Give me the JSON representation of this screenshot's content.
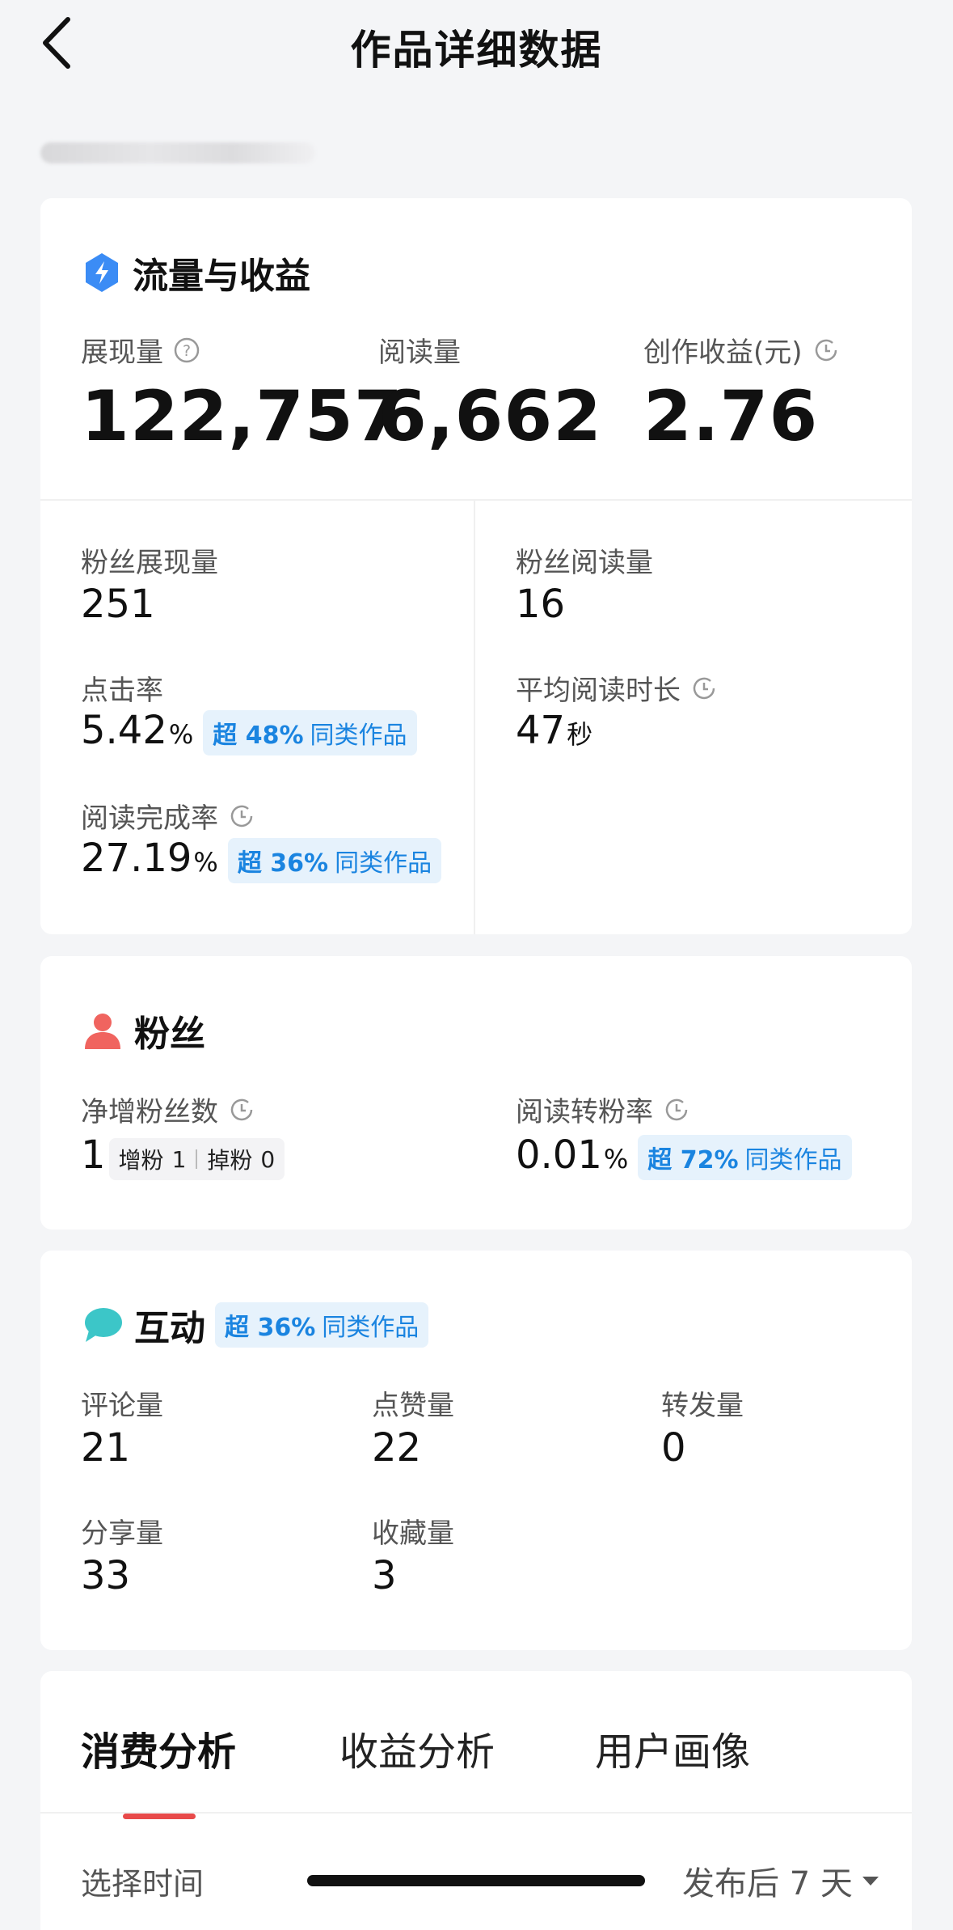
{
  "header": {
    "title": "作品详细数据"
  },
  "traffic": {
    "title": "流量与收益",
    "impressions_label": "展现量",
    "impressions_value": "122,757",
    "reads_label": "阅读量",
    "reads_value": "6,662",
    "earnings_label": "创作收益(元)",
    "earnings_value": "2.76",
    "fan_impressions_label": "粉丝展现量",
    "fan_impressions_value": "251",
    "fan_reads_label": "粉丝阅读量",
    "fan_reads_value": "16",
    "ctr_label": "点击率",
    "ctr_value": "5.42",
    "ctr_unit": "%",
    "ctr_badge_strong": "超 48%",
    "ctr_badge_rest": "同类作品",
    "avg_read_label": "平均阅读时长",
    "avg_read_value": "47",
    "avg_read_unit": "秒",
    "completion_label": "阅读完成率",
    "completion_value": "27.19",
    "completion_unit": "%",
    "completion_badge_strong": "超 36%",
    "completion_badge_rest": "同类作品"
  },
  "fans": {
    "title": "粉丝",
    "net_label": "净增粉丝数",
    "net_value": "1",
    "gain_label": "增粉",
    "gain_value": "1",
    "loss_label": "掉粉",
    "loss_value": "0",
    "conv_label": "阅读转粉率",
    "conv_value": "0.01",
    "conv_unit": "%",
    "conv_badge_strong": "超 72%",
    "conv_badge_rest": "同类作品"
  },
  "interaction": {
    "title": "互动",
    "badge_strong": "超 36%",
    "badge_rest": "同类作品",
    "comments_label": "评论量",
    "comments_value": "21",
    "likes_label": "点赞量",
    "likes_value": "22",
    "reposts_label": "转发量",
    "reposts_value": "0",
    "shares_label": "分享量",
    "shares_value": "33",
    "favorites_label": "收藏量",
    "favorites_value": "3"
  },
  "analysis": {
    "tabs": [
      "消费分析",
      "收益分析",
      "用户画像"
    ],
    "time_label": "选择时间",
    "time_value": "发布后 7 天"
  },
  "colors": {
    "accent_blue": "#1a84e0",
    "badge_bg": "#e6f2fc",
    "tab_underline": "#e84a4a",
    "fan_icon": "#f0645f",
    "chat_icon": "#3cc6c8",
    "bolt_icon": "#3b8cf5"
  },
  "icons": [
    "back-arrow-icon",
    "bolt-shield-icon",
    "help-circle-icon",
    "clock-refresh-icon",
    "person-icon",
    "chat-bubble-icon",
    "caret-down-icon"
  ]
}
